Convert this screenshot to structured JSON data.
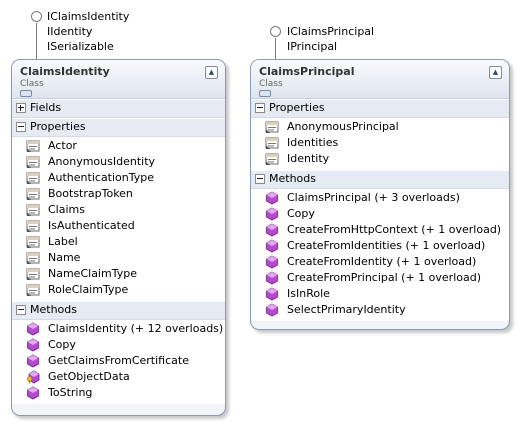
{
  "left_interfaces": [
    "IClaimsIdentity",
    "IIdentity",
    "ISerializable"
  ],
  "right_interfaces": [
    "IClaimsPrincipal",
    "IPrincipal"
  ],
  "claims_identity": {
    "name": "ClaimsIdentity",
    "kind": "Class",
    "fields_label": "Fields",
    "properties_label": "Properties",
    "properties": [
      "Actor",
      "AnonymousIdentity",
      "AuthenticationType",
      "BootstrapToken",
      "Claims",
      "IsAuthenticated",
      "Label",
      "Name",
      "NameClaimType",
      "RoleClaimType"
    ],
    "methods_label": "Methods",
    "methods": [
      "ClaimsIdentity (+ 12 overloads)",
      "Copy",
      "GetClaimsFromCertificate",
      "GetObjectData",
      "ToString"
    ]
  },
  "claims_principal": {
    "name": "ClaimsPrincipal",
    "kind": "Class",
    "properties_label": "Properties",
    "properties": [
      "AnonymousPrincipal",
      "Identities",
      "Identity"
    ],
    "methods_label": "Methods",
    "methods": [
      "ClaimsPrincipal (+ 3 overloads)",
      "Copy",
      "CreateFromHttpContext (+ 1 overload)",
      "CreateFromIdentities (+ 1 overload)",
      "CreateFromIdentity (+ 1 overload)",
      "CreateFromPrincipal (+ 1 overload)",
      "IsInRole",
      "SelectPrimaryIdentity"
    ]
  },
  "icons": {
    "property": "property-icon",
    "method": "method-icon",
    "protected_method": "protected-method-icon",
    "collapse": "chevron-up-icon"
  }
}
